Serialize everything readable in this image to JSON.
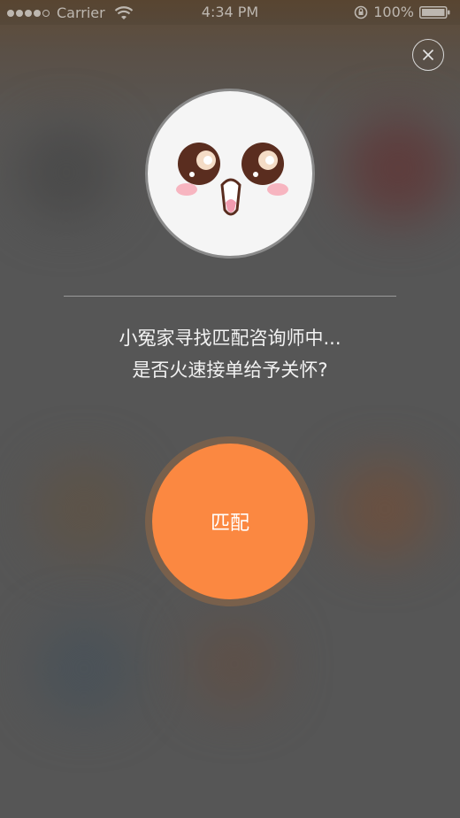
{
  "status_bar": {
    "carrier": "Carrier",
    "time": "4:34 PM",
    "battery": "100%"
  },
  "dialog": {
    "close_icon": "close-icon",
    "avatar_icon": "bunny-face-icon",
    "message_line1": "小冤家寻找匹配咨询师中...",
    "message_line2": "是否火速接单给予关怀?",
    "match_button_label": "匹配"
  },
  "colors": {
    "accent": "#fb8841",
    "overlay": "#565656",
    "text": "#f2f2f2"
  }
}
